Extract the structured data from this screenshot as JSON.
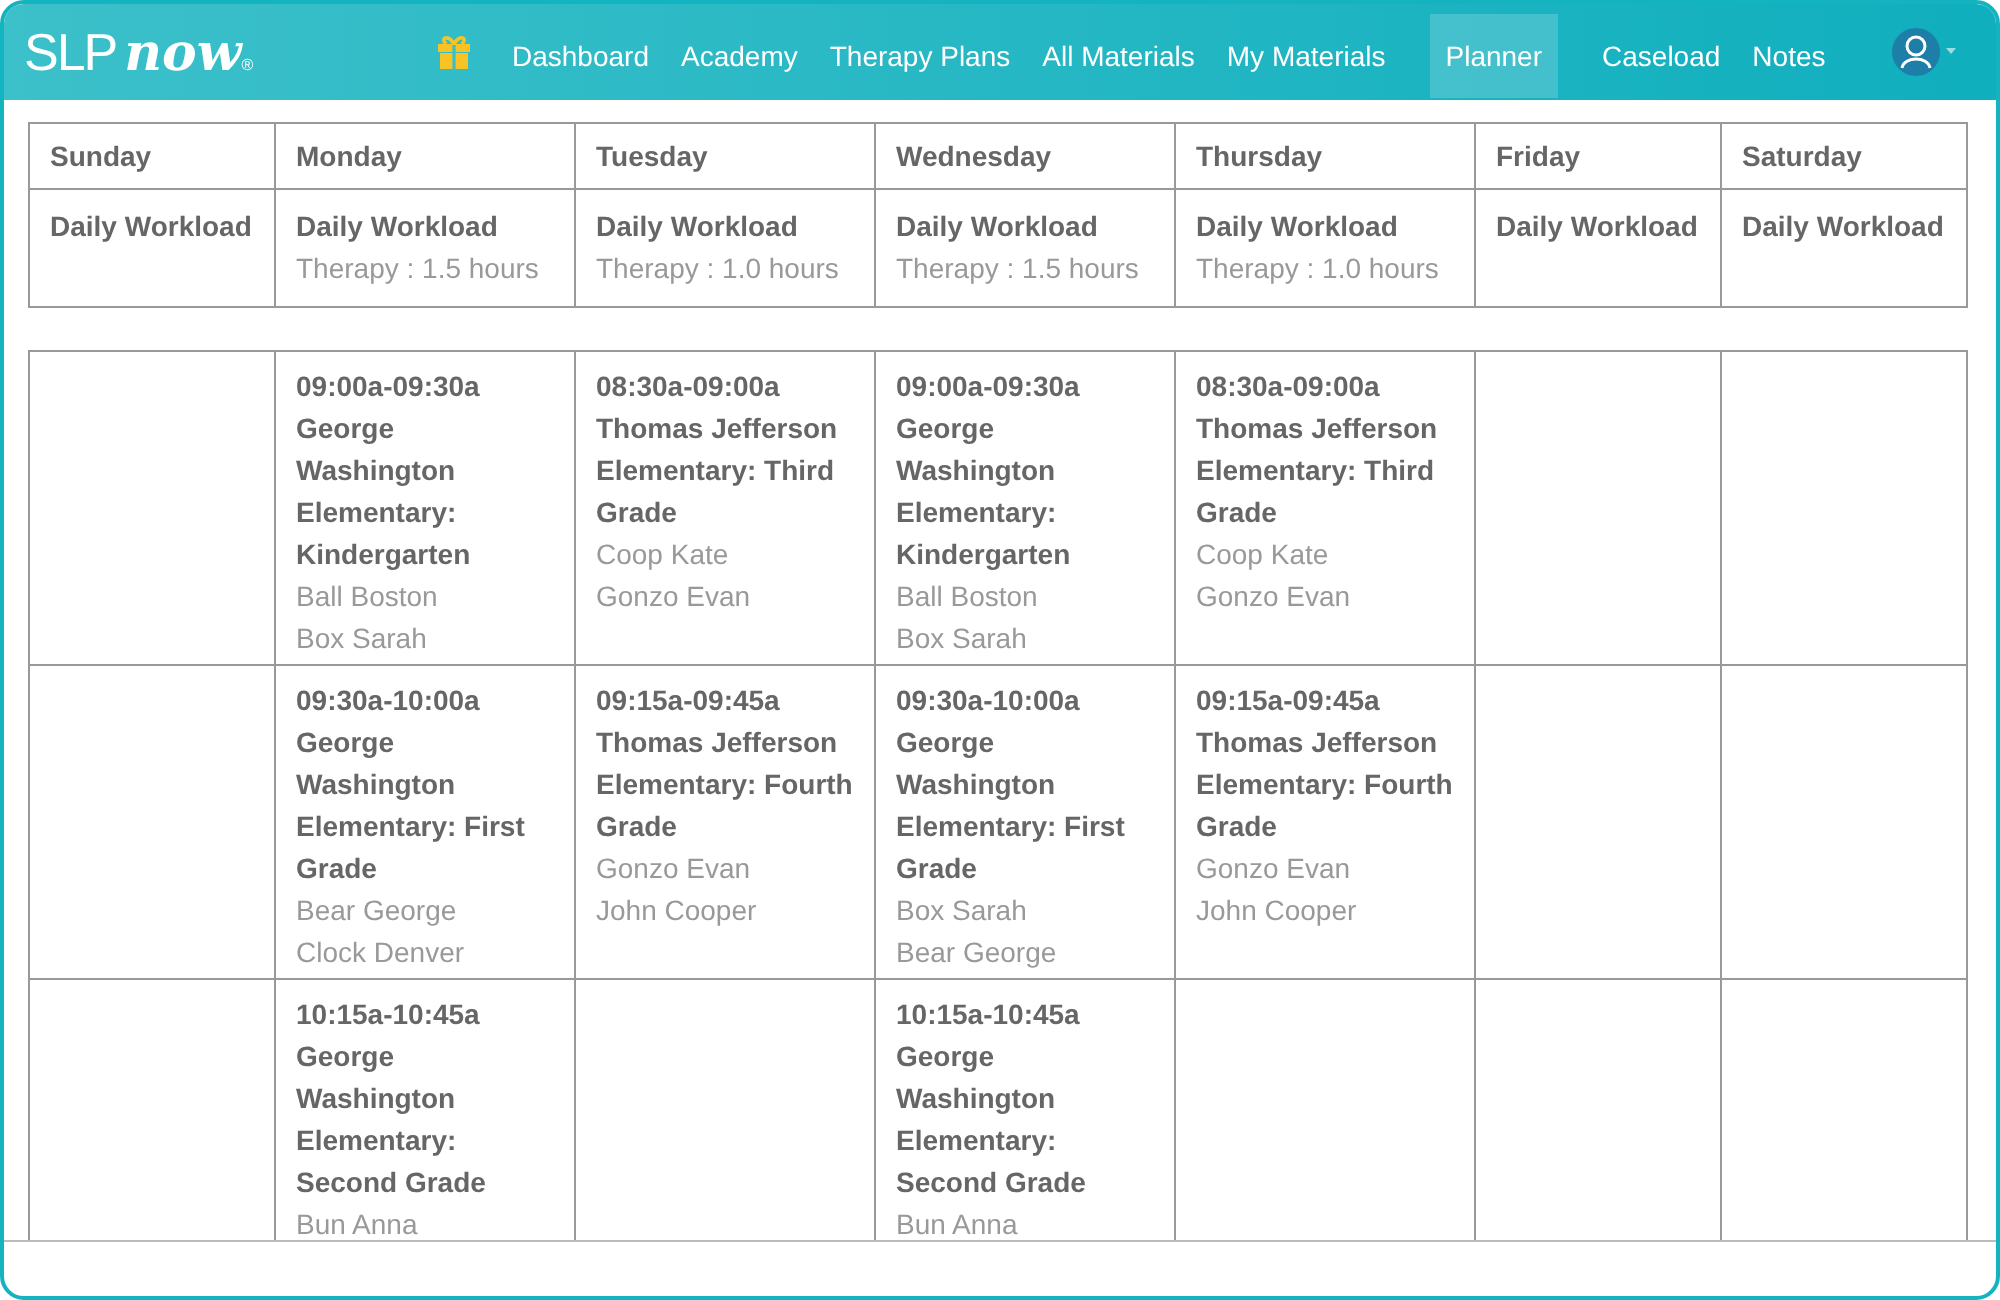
{
  "logo": {
    "left": "SLP",
    "right": "now",
    "mark": "®"
  },
  "nav": [
    {
      "label": "Dashboard",
      "selected": false
    },
    {
      "label": "Academy",
      "selected": false
    },
    {
      "label": "Therapy Plans",
      "selected": false
    },
    {
      "label": "All Materials",
      "selected": false
    },
    {
      "label": "My Materials",
      "selected": false
    },
    {
      "label": "Planner",
      "selected": true
    },
    {
      "label": "Caseload",
      "selected": false
    },
    {
      "label": "Notes",
      "selected": false
    }
  ],
  "days": [
    {
      "name": "Sunday",
      "workload": "Daily Workload"
    },
    {
      "name": "Monday",
      "workload": "Daily Workload",
      "therapy": "Therapy : 1.5 hours"
    },
    {
      "name": "Tuesday",
      "workload": "Daily Workload",
      "therapy": "Therapy : 1.0 hours"
    },
    {
      "name": "Wednesday",
      "workload": "Daily Workload",
      "therapy": "Therapy : 1.5 hours"
    },
    {
      "name": "Thursday",
      "workload": "Daily Workload",
      "therapy": "Therapy : 1.0 hours"
    },
    {
      "name": "Friday",
      "workload": "Daily Workload"
    },
    {
      "name": "Saturday",
      "workload": "Daily Workload"
    }
  ],
  "schedule": [
    {
      "monday": {
        "time": "09:00a-09:30a",
        "group": "George Washington Elementary: Kindergarten",
        "students": [
          "Ball Boston",
          "Box Sarah"
        ]
      },
      "tuesday": {
        "time": "08:30a-09:00a",
        "group": "Thomas Jefferson Elementary: Third Grade",
        "students": [
          "Coop Kate",
          "Gonzo Evan"
        ]
      },
      "wednesday": {
        "time": "09:00a-09:30a",
        "group": "George Washington Elementary: Kindergarten",
        "students": [
          "Ball Boston",
          "Box Sarah"
        ]
      },
      "thursday": {
        "time": "08:30a-09:00a",
        "group": "Thomas Jefferson Elementary: Third Grade",
        "students": [
          "Coop Kate",
          "Gonzo Evan"
        ]
      }
    },
    {
      "monday": {
        "time": "09:30a-10:00a",
        "group": "George Washington Elementary: First Grade",
        "students": [
          "Bear George",
          "Clock Denver"
        ]
      },
      "tuesday": {
        "time": "09:15a-09:45a",
        "group": "Thomas Jefferson Elementary: Fourth Grade",
        "students": [
          "Gonzo Evan",
          "John Cooper"
        ]
      },
      "wednesday": {
        "time": "09:30a-10:00a",
        "group": "George Washington Elementary: First Grade",
        "students": [
          "Box Sarah",
          "Bear George"
        ]
      },
      "thursday": {
        "time": "09:15a-09:45a",
        "group": "Thomas Jefferson Elementary: Fourth Grade",
        "students": [
          "Gonzo Evan",
          "John Cooper"
        ]
      }
    },
    {
      "monday": {
        "time": "10:15a-10:45a",
        "group": "George Washington Elementary: Second Grade",
        "students": [
          "Bun Anna"
        ]
      },
      "wednesday": {
        "time": "10:15a-10:45a",
        "group": "George Washington Elementary: Second Grade",
        "students": [
          "Bun Anna"
        ]
      }
    }
  ]
}
